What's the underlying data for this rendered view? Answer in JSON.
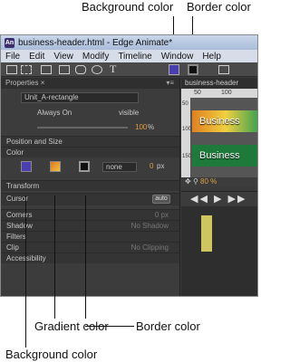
{
  "callouts": {
    "top_background": "Background color",
    "top_border": "Border color",
    "bottom_gradient": "Gradient color",
    "bottom_border": "Border color",
    "bottom_background": "Background color"
  },
  "window": {
    "title": "business-header.html - Edge Animate*",
    "menu": [
      "File",
      "Edit",
      "View",
      "Modify",
      "Timeline",
      "Window",
      "Help"
    ]
  },
  "colors": {
    "background_swatch": "#4a3fb0",
    "border_swatch": "#111111",
    "gradient_swatch": "#e07820",
    "accent_value": "#e0a040"
  },
  "properties": {
    "tab": "Properties",
    "element_name": "Unit_A-rectangle",
    "always_on": "Always On",
    "visible": "visible",
    "opacity": "100",
    "opacity_unit": "%",
    "sections": {
      "position_size": "Position and Size",
      "color": "Color",
      "transform": "Transform",
      "cursor": "Cursor",
      "cursor_value": "auto",
      "corners": "Corners",
      "corners_value": "0 px",
      "shadow": "Shadow",
      "shadow_value": "No Shadow",
      "filters": "Filters",
      "clip": "Clip",
      "clip_value": "No Clipping",
      "accessibility": "Accessibility"
    },
    "border_style": "none",
    "border_width": "0",
    "border_unit": "px"
  },
  "stage": {
    "tab": "business-header",
    "ruler_marks": [
      "50",
      "100"
    ],
    "vruler_marks": [
      "50",
      "100",
      "150"
    ],
    "banner_text": "Business",
    "zoom": "80 %"
  }
}
